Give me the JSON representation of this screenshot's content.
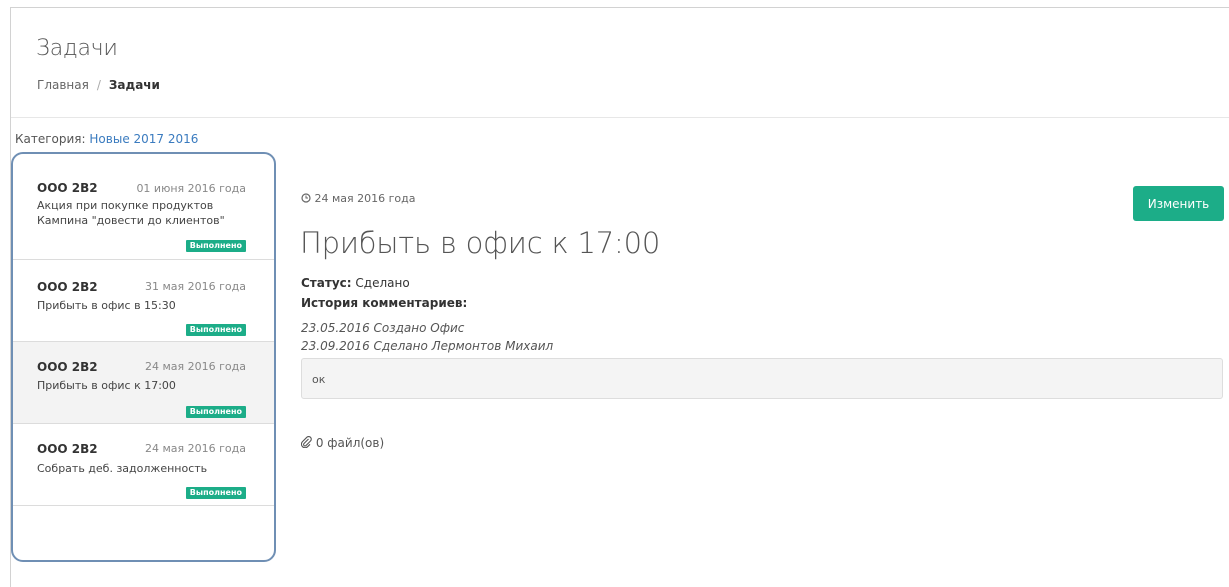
{
  "header": {
    "title": "Задачи",
    "breadcrumb": {
      "home": "Главная",
      "separator": "/",
      "current": "Задачи"
    }
  },
  "category": {
    "label": "Категория:",
    "value": "Новые 2017 2016"
  },
  "tasks": [
    {
      "company": "ООО 2B2",
      "date": "01 июня 2016 года",
      "desc1": "Акция при покупке продуктов",
      "desc2": "Кампина \"довести до клиентов\"",
      "status": "Выполнено"
    },
    {
      "company": "ООО 2B2",
      "date": "31 мая 2016 года",
      "desc1": "Прибыть в офис в 15:30",
      "status": "Выполнено"
    },
    {
      "company": "ООО 2B2",
      "date": "24 мая 2016 года",
      "desc1": "Прибыть в офис к 17:00",
      "status": "Выполнено"
    },
    {
      "company": "ООО 2B2",
      "date": "24 мая 2016 года",
      "desc1": "Собрать деб. задолженность",
      "status": "Выполнено"
    }
  ],
  "detail": {
    "date": "24 мая 2016 года",
    "edit_label": "Изменить",
    "title": "Прибыть в офис к 17:00",
    "status_label": "Статус:",
    "status_value": "Сделано",
    "history_label": "История комментариев:",
    "history": [
      "23.05.2016 Создано Офис",
      "23.09.2016 Сделано Лермонтов Михаил"
    ],
    "comment": "ок",
    "files": "0 файл(ов)"
  },
  "icons": {
    "clock": "clock-icon",
    "paperclip": "paperclip-icon"
  },
  "colors": {
    "accent": "#1cad88",
    "link": "#3a7bbf",
    "list_border": "#6f8fb4"
  }
}
